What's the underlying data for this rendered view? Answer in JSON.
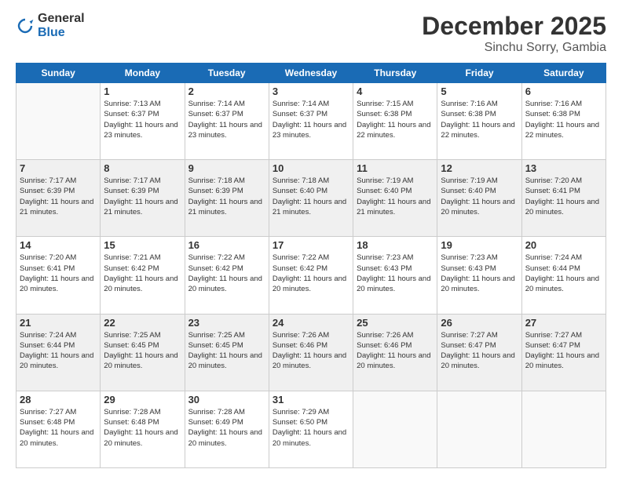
{
  "logo": {
    "general": "General",
    "blue": "Blue"
  },
  "title": "December 2025",
  "location": "Sinchu Sorry, Gambia",
  "days_of_week": [
    "Sunday",
    "Monday",
    "Tuesday",
    "Wednesday",
    "Thursday",
    "Friday",
    "Saturday"
  ],
  "weeks": [
    [
      {
        "day": "",
        "sunrise": "",
        "sunset": "",
        "daylight": ""
      },
      {
        "day": "1",
        "sunrise": "Sunrise: 7:13 AM",
        "sunset": "Sunset: 6:37 PM",
        "daylight": "Daylight: 11 hours and 23 minutes."
      },
      {
        "day": "2",
        "sunrise": "Sunrise: 7:14 AM",
        "sunset": "Sunset: 6:37 PM",
        "daylight": "Daylight: 11 hours and 23 minutes."
      },
      {
        "day": "3",
        "sunrise": "Sunrise: 7:14 AM",
        "sunset": "Sunset: 6:37 PM",
        "daylight": "Daylight: 11 hours and 23 minutes."
      },
      {
        "day": "4",
        "sunrise": "Sunrise: 7:15 AM",
        "sunset": "Sunset: 6:38 PM",
        "daylight": "Daylight: 11 hours and 22 minutes."
      },
      {
        "day": "5",
        "sunrise": "Sunrise: 7:16 AM",
        "sunset": "Sunset: 6:38 PM",
        "daylight": "Daylight: 11 hours and 22 minutes."
      },
      {
        "day": "6",
        "sunrise": "Sunrise: 7:16 AM",
        "sunset": "Sunset: 6:38 PM",
        "daylight": "Daylight: 11 hours and 22 minutes."
      }
    ],
    [
      {
        "day": "7",
        "sunrise": "Sunrise: 7:17 AM",
        "sunset": "Sunset: 6:39 PM",
        "daylight": "Daylight: 11 hours and 21 minutes."
      },
      {
        "day": "8",
        "sunrise": "Sunrise: 7:17 AM",
        "sunset": "Sunset: 6:39 PM",
        "daylight": "Daylight: 11 hours and 21 minutes."
      },
      {
        "day": "9",
        "sunrise": "Sunrise: 7:18 AM",
        "sunset": "Sunset: 6:39 PM",
        "daylight": "Daylight: 11 hours and 21 minutes."
      },
      {
        "day": "10",
        "sunrise": "Sunrise: 7:18 AM",
        "sunset": "Sunset: 6:40 PM",
        "daylight": "Daylight: 11 hours and 21 minutes."
      },
      {
        "day": "11",
        "sunrise": "Sunrise: 7:19 AM",
        "sunset": "Sunset: 6:40 PM",
        "daylight": "Daylight: 11 hours and 21 minutes."
      },
      {
        "day": "12",
        "sunrise": "Sunrise: 7:19 AM",
        "sunset": "Sunset: 6:40 PM",
        "daylight": "Daylight: 11 hours and 20 minutes."
      },
      {
        "day": "13",
        "sunrise": "Sunrise: 7:20 AM",
        "sunset": "Sunset: 6:41 PM",
        "daylight": "Daylight: 11 hours and 20 minutes."
      }
    ],
    [
      {
        "day": "14",
        "sunrise": "Sunrise: 7:20 AM",
        "sunset": "Sunset: 6:41 PM",
        "daylight": "Daylight: 11 hours and 20 minutes."
      },
      {
        "day": "15",
        "sunrise": "Sunrise: 7:21 AM",
        "sunset": "Sunset: 6:42 PM",
        "daylight": "Daylight: 11 hours and 20 minutes."
      },
      {
        "day": "16",
        "sunrise": "Sunrise: 7:22 AM",
        "sunset": "Sunset: 6:42 PM",
        "daylight": "Daylight: 11 hours and 20 minutes."
      },
      {
        "day": "17",
        "sunrise": "Sunrise: 7:22 AM",
        "sunset": "Sunset: 6:42 PM",
        "daylight": "Daylight: 11 hours and 20 minutes."
      },
      {
        "day": "18",
        "sunrise": "Sunrise: 7:23 AM",
        "sunset": "Sunset: 6:43 PM",
        "daylight": "Daylight: 11 hours and 20 minutes."
      },
      {
        "day": "19",
        "sunrise": "Sunrise: 7:23 AM",
        "sunset": "Sunset: 6:43 PM",
        "daylight": "Daylight: 11 hours and 20 minutes."
      },
      {
        "day": "20",
        "sunrise": "Sunrise: 7:24 AM",
        "sunset": "Sunset: 6:44 PM",
        "daylight": "Daylight: 11 hours and 20 minutes."
      }
    ],
    [
      {
        "day": "21",
        "sunrise": "Sunrise: 7:24 AM",
        "sunset": "Sunset: 6:44 PM",
        "daylight": "Daylight: 11 hours and 20 minutes."
      },
      {
        "day": "22",
        "sunrise": "Sunrise: 7:25 AM",
        "sunset": "Sunset: 6:45 PM",
        "daylight": "Daylight: 11 hours and 20 minutes."
      },
      {
        "day": "23",
        "sunrise": "Sunrise: 7:25 AM",
        "sunset": "Sunset: 6:45 PM",
        "daylight": "Daylight: 11 hours and 20 minutes."
      },
      {
        "day": "24",
        "sunrise": "Sunrise: 7:26 AM",
        "sunset": "Sunset: 6:46 PM",
        "daylight": "Daylight: 11 hours and 20 minutes."
      },
      {
        "day": "25",
        "sunrise": "Sunrise: 7:26 AM",
        "sunset": "Sunset: 6:46 PM",
        "daylight": "Daylight: 11 hours and 20 minutes."
      },
      {
        "day": "26",
        "sunrise": "Sunrise: 7:27 AM",
        "sunset": "Sunset: 6:47 PM",
        "daylight": "Daylight: 11 hours and 20 minutes."
      },
      {
        "day": "27",
        "sunrise": "Sunrise: 7:27 AM",
        "sunset": "Sunset: 6:47 PM",
        "daylight": "Daylight: 11 hours and 20 minutes."
      }
    ],
    [
      {
        "day": "28",
        "sunrise": "Sunrise: 7:27 AM",
        "sunset": "Sunset: 6:48 PM",
        "daylight": "Daylight: 11 hours and 20 minutes."
      },
      {
        "day": "29",
        "sunrise": "Sunrise: 7:28 AM",
        "sunset": "Sunset: 6:48 PM",
        "daylight": "Daylight: 11 hours and 20 minutes."
      },
      {
        "day": "30",
        "sunrise": "Sunrise: 7:28 AM",
        "sunset": "Sunset: 6:49 PM",
        "daylight": "Daylight: 11 hours and 20 minutes."
      },
      {
        "day": "31",
        "sunrise": "Sunrise: 7:29 AM",
        "sunset": "Sunset: 6:50 PM",
        "daylight": "Daylight: 11 hours and 20 minutes."
      },
      {
        "day": "",
        "sunrise": "",
        "sunset": "",
        "daylight": ""
      },
      {
        "day": "",
        "sunrise": "",
        "sunset": "",
        "daylight": ""
      },
      {
        "day": "",
        "sunrise": "",
        "sunset": "",
        "daylight": ""
      }
    ]
  ]
}
